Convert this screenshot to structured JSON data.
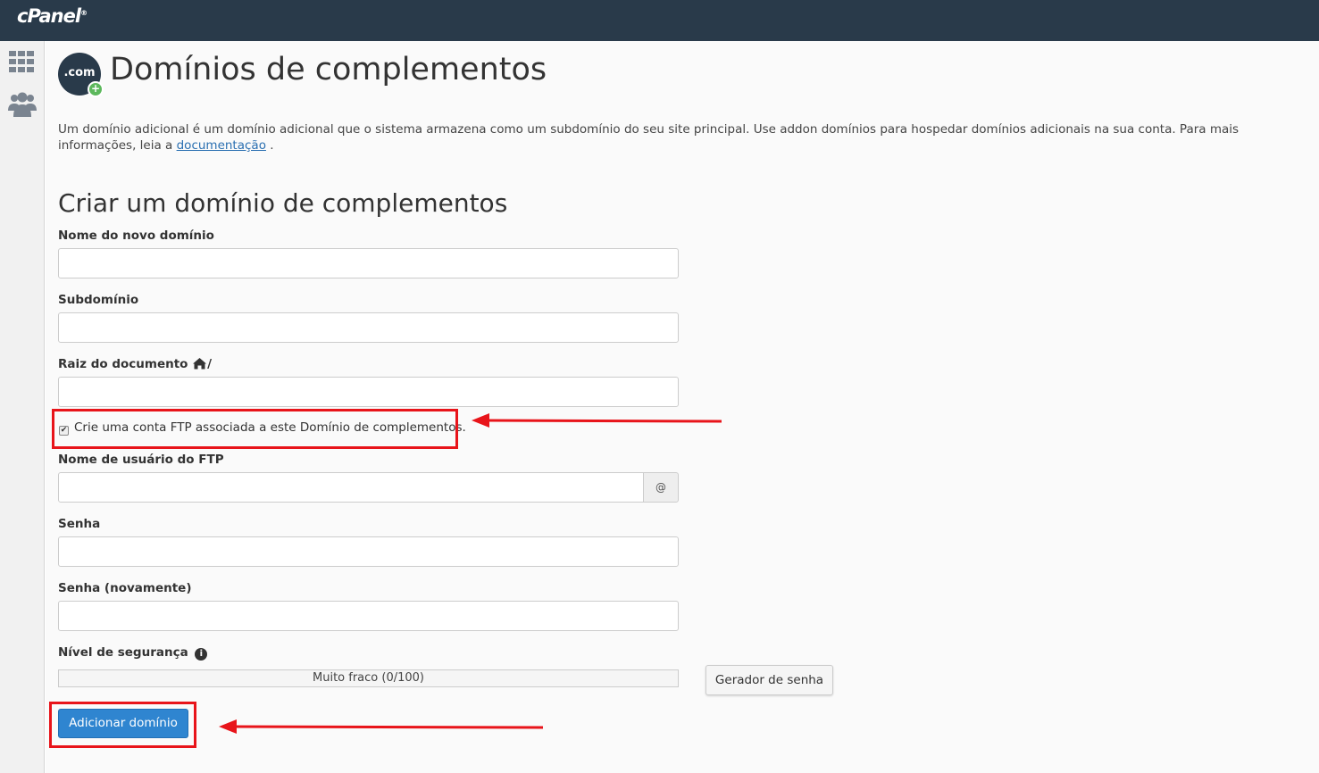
{
  "app": {
    "logo": "cPanel",
    "logo_mark": "®"
  },
  "page": {
    "title": "Domínios de complementos",
    "icon_text": ".com",
    "intro_text": "Um domínio adicional é um domínio adicional que o sistema armazena como um subdomínio do seu site principal. Use addon domínios para hospedar domínios adicionais na sua conta. Para mais informações, leia a ",
    "intro_link": "documentação",
    "intro_end": " ."
  },
  "form": {
    "section_title": "Criar um domínio de complementos",
    "new_domain_label": "Nome do novo domínio",
    "new_domain_value": "",
    "subdomain_label": "Subdomínio",
    "subdomain_value": "",
    "docroot_label": "Raiz do documento",
    "docroot_suffix": "/",
    "docroot_value": "",
    "ftp_checkbox_label": "Crie uma conta FTP associada a este Domínio de complementos.",
    "ftp_checkbox_checked": true,
    "ftp_user_label": "Nome de usuário do FTP",
    "ftp_user_value": "",
    "ftp_user_addon": "@",
    "password_label": "Senha",
    "password_value": "",
    "password2_label": "Senha (novamente)",
    "password2_value": "",
    "strength_label": "Nível de segurança",
    "strength_text": "Muito fraco (0/100)",
    "strength_value": 0,
    "generator_button": "Gerador de senha",
    "submit_button": "Adicionar domínio"
  },
  "colors": {
    "topbar": "#293a4a",
    "primary": "#2f85d0",
    "annotation": "#e8141a"
  }
}
